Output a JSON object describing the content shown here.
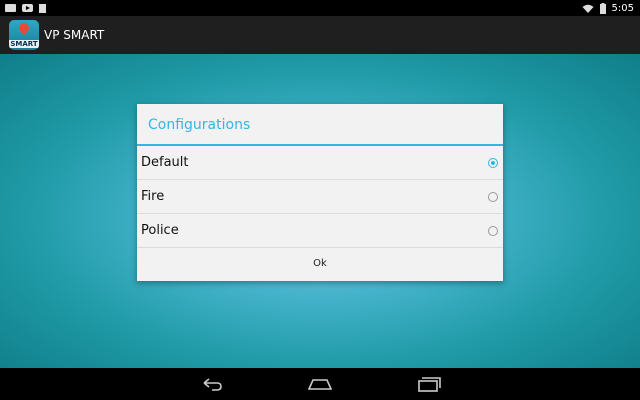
{
  "status_bar": {
    "time": "5:05",
    "icons": [
      "mail-icon",
      "youtube-icon",
      "sd-card-icon",
      "wifi-icon",
      "battery-icon"
    ]
  },
  "app_bar": {
    "icon_text": "SMART",
    "title": "VP SMART"
  },
  "dialog": {
    "title": "Configurations",
    "options": [
      {
        "label": "Default",
        "checked": true
      },
      {
        "label": "Fire",
        "checked": false
      },
      {
        "label": "Police",
        "checked": false
      }
    ],
    "ok_label": "Ok"
  },
  "nav_bar": {
    "icons": [
      "back-icon",
      "home-icon",
      "recent-apps-icon"
    ]
  },
  "colors": {
    "accent": "#33b5e5",
    "app_bar": "#1f1f1f",
    "dialog_bg": "#f2f2f2"
  }
}
